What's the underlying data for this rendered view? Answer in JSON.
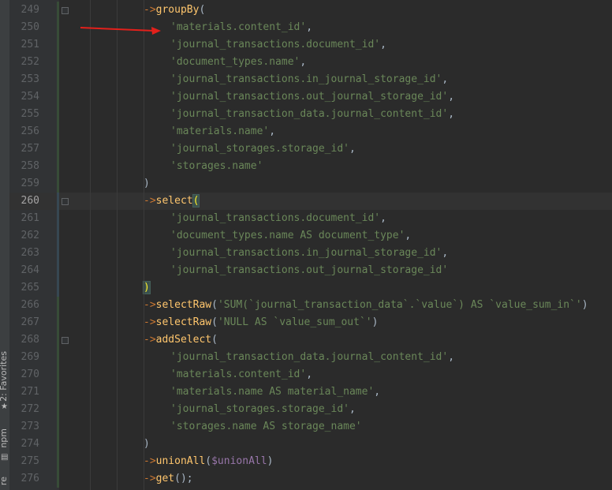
{
  "side_panel": {
    "favorites_label": "2: Favorites",
    "npm_label": "npm",
    "structure_label": "re"
  },
  "annotation": {
    "color": "#e3201b"
  },
  "editor": {
    "lines": [
      {
        "n": "249",
        "segments": [
          {
            "t": "->",
            "c": "op"
          },
          {
            "t": "groupBy",
            "c": "m"
          },
          {
            "t": "(",
            "c": "p"
          }
        ],
        "indent": 2
      },
      {
        "n": "250",
        "segments": [
          {
            "t": "'materials.content_id'",
            "c": "s"
          },
          {
            "t": ",",
            "c": "p"
          }
        ],
        "indent": 3
      },
      {
        "n": "251",
        "segments": [
          {
            "t": "'journal_transactions.document_id'",
            "c": "s"
          },
          {
            "t": ",",
            "c": "p"
          }
        ],
        "indent": 3
      },
      {
        "n": "252",
        "segments": [
          {
            "t": "'document_types.name'",
            "c": "s"
          },
          {
            "t": ",",
            "c": "p"
          }
        ],
        "indent": 3
      },
      {
        "n": "253",
        "segments": [
          {
            "t": "'journal_transactions.in_journal_storage_id'",
            "c": "s"
          },
          {
            "t": ",",
            "c": "p"
          }
        ],
        "indent": 3
      },
      {
        "n": "254",
        "segments": [
          {
            "t": "'journal_transactions.out_journal_storage_id'",
            "c": "s"
          },
          {
            "t": ",",
            "c": "p"
          }
        ],
        "indent": 3
      },
      {
        "n": "255",
        "segments": [
          {
            "t": "'journal_transaction_data.journal_content_id'",
            "c": "s"
          },
          {
            "t": ",",
            "c": "p"
          }
        ],
        "indent": 3
      },
      {
        "n": "256",
        "segments": [
          {
            "t": "'materials.name'",
            "c": "s"
          },
          {
            "t": ",",
            "c": "p"
          }
        ],
        "indent": 3
      },
      {
        "n": "257",
        "segments": [
          {
            "t": "'journal_storages.storage_id'",
            "c": "s"
          },
          {
            "t": ",",
            "c": "p"
          }
        ],
        "indent": 3
      },
      {
        "n": "258",
        "segments": [
          {
            "t": "'storages.name'",
            "c": "s"
          }
        ],
        "indent": 3
      },
      {
        "n": "259",
        "segments": [
          {
            "t": ")",
            "c": "p"
          }
        ],
        "indent": 2
      },
      {
        "n": "260",
        "segments": [
          {
            "t": "->",
            "c": "op"
          },
          {
            "t": "select",
            "c": "m"
          },
          {
            "t": "(",
            "c": "pm"
          }
        ],
        "indent": 2,
        "current": true
      },
      {
        "n": "261",
        "segments": [
          {
            "t": "'journal_transactions.document_id'",
            "c": "s"
          },
          {
            "t": ",",
            "c": "p"
          }
        ],
        "indent": 3
      },
      {
        "n": "262",
        "segments": [
          {
            "t": "'document_types.name AS document_type'",
            "c": "s"
          },
          {
            "t": ",",
            "c": "p"
          }
        ],
        "indent": 3
      },
      {
        "n": "263",
        "segments": [
          {
            "t": "'journal_transactions.in_journal_storage_id'",
            "c": "s"
          },
          {
            "t": ",",
            "c": "p"
          }
        ],
        "indent": 3
      },
      {
        "n": "264",
        "segments": [
          {
            "t": "'journal_transactions.out_journal_storage_id'",
            "c": "s"
          }
        ],
        "indent": 3
      },
      {
        "n": "265",
        "segments": [
          {
            "t": ")",
            "c": "pm"
          }
        ],
        "indent": 2
      },
      {
        "n": "266",
        "segments": [
          {
            "t": "->",
            "c": "op"
          },
          {
            "t": "selectRaw",
            "c": "m"
          },
          {
            "t": "(",
            "c": "p"
          },
          {
            "t": "'SUM(`journal_transaction_data`.`value`) AS `value_sum_in`'",
            "c": "s"
          },
          {
            "t": ")",
            "c": "p"
          }
        ],
        "indent": 2
      },
      {
        "n": "267",
        "segments": [
          {
            "t": "->",
            "c": "op"
          },
          {
            "t": "selectRaw",
            "c": "m"
          },
          {
            "t": "(",
            "c": "p"
          },
          {
            "t": "'NULL AS `value_sum_out`'",
            "c": "s"
          },
          {
            "t": ")",
            "c": "p"
          }
        ],
        "indent": 2
      },
      {
        "n": "268",
        "segments": [
          {
            "t": "->",
            "c": "op"
          },
          {
            "t": "addSelect",
            "c": "m"
          },
          {
            "t": "(",
            "c": "p"
          }
        ],
        "indent": 2
      },
      {
        "n": "269",
        "segments": [
          {
            "t": "'journal_transaction_data.journal_content_id'",
            "c": "s"
          },
          {
            "t": ",",
            "c": "p"
          }
        ],
        "indent": 3
      },
      {
        "n": "270",
        "segments": [
          {
            "t": "'materials.content_id'",
            "c": "s"
          },
          {
            "t": ",",
            "c": "p"
          }
        ],
        "indent": 3
      },
      {
        "n": "271",
        "segments": [
          {
            "t": "'materials.name AS material_name'",
            "c": "s"
          },
          {
            "t": ",",
            "c": "p"
          }
        ],
        "indent": 3
      },
      {
        "n": "272",
        "segments": [
          {
            "t": "'journal_storages.storage_id'",
            "c": "s"
          },
          {
            "t": ",",
            "c": "p"
          }
        ],
        "indent": 3
      },
      {
        "n": "273",
        "segments": [
          {
            "t": "'storages.name AS storage_name'",
            "c": "s"
          }
        ],
        "indent": 3
      },
      {
        "n": "274",
        "segments": [
          {
            "t": ")",
            "c": "p"
          }
        ],
        "indent": 2
      },
      {
        "n": "275",
        "segments": [
          {
            "t": "->",
            "c": "op"
          },
          {
            "t": "unionAll",
            "c": "m"
          },
          {
            "t": "(",
            "c": "p"
          },
          {
            "t": "$unionAll",
            "c": "v"
          },
          {
            "t": ")",
            "c": "p"
          }
        ],
        "indent": 2
      },
      {
        "n": "276",
        "segments": [
          {
            "t": "->",
            "c": "op"
          },
          {
            "t": "get",
            "c": "m"
          },
          {
            "t": "();",
            "c": "p"
          }
        ],
        "indent": 2
      }
    ]
  }
}
